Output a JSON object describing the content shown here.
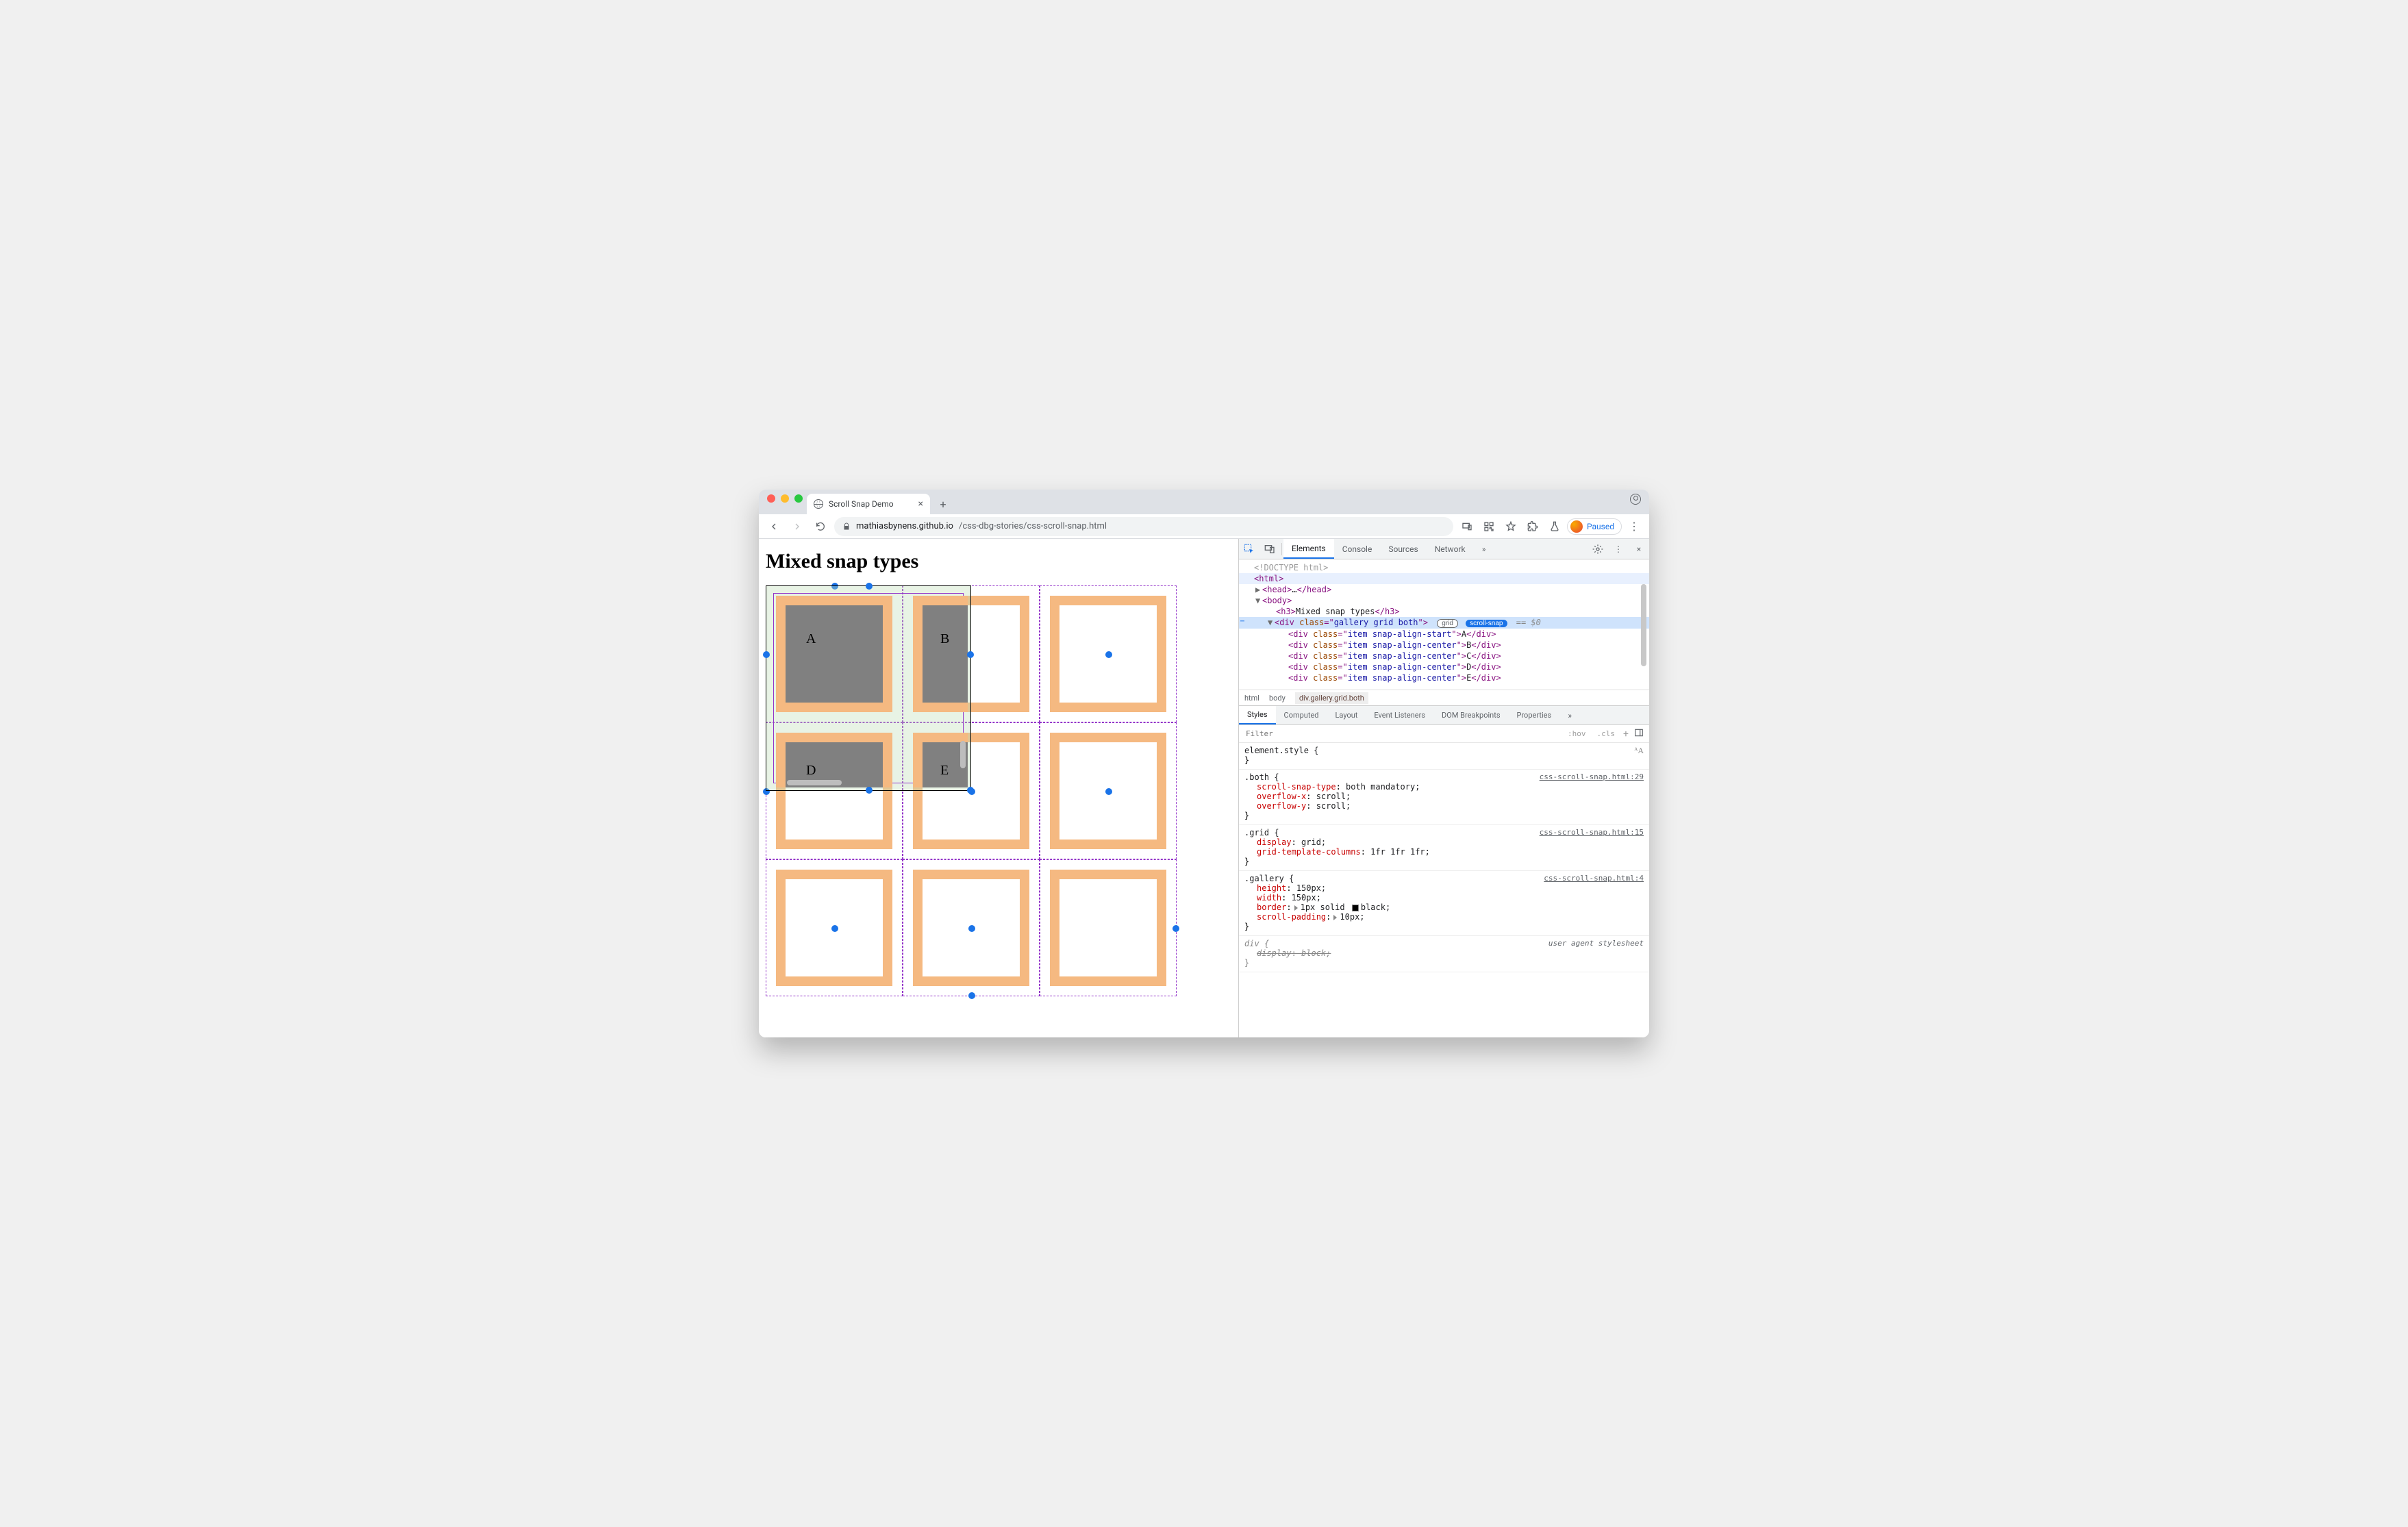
{
  "browser": {
    "tab_title": "Scroll Snap Demo",
    "url_domain": "mathiasbynens.github.io",
    "url_path": "/css-dbg-stories/css-scroll-snap.html",
    "paused_label": "Paused"
  },
  "page": {
    "heading": "Mixed snap types",
    "gallery_items": [
      "A",
      "B",
      "D",
      "E"
    ]
  },
  "devtools": {
    "tabs": [
      "Elements",
      "Console",
      "Sources",
      "Network"
    ],
    "dom": {
      "doctype": "<!DOCTYPE html>",
      "html_open": "<html>",
      "head": {
        "open": "<head>",
        "ellipsis": "…",
        "close": "</head>"
      },
      "body_open": "<body>",
      "h3": {
        "open": "<h3>",
        "text": "Mixed snap types",
        "close": "</h3>"
      },
      "gallery": {
        "tag": "div",
        "class_attr": "class",
        "class_val": "gallery grid both",
        "badge_grid": "grid",
        "badge_snap": "scroll-snap",
        "eq": "== $0"
      },
      "items": [
        {
          "cls": "item snap-align-start",
          "txt": "A"
        },
        {
          "cls": "item snap-align-center",
          "txt": "B"
        },
        {
          "cls": "item snap-align-center",
          "txt": "C"
        },
        {
          "cls": "item snap-align-center",
          "txt": "D"
        },
        {
          "cls": "item snap-align-center",
          "txt": "E"
        }
      ]
    },
    "crumbs": [
      "html",
      "body",
      "div.gallery.grid.both"
    ],
    "styles_tabs": [
      "Styles",
      "Computed",
      "Layout",
      "Event Listeners",
      "DOM Breakpoints",
      "Properties"
    ],
    "filter_placeholder": "Filter",
    "hov": ":hov",
    "cls": ".cls",
    "rules": {
      "element_style": "element.style {",
      "both": {
        "sel": ".both {",
        "src": "css-scroll-snap.html:29",
        "p1": "scroll-snap-type",
        "v1": "both mandatory;",
        "p2": "overflow-x",
        "v2": "scroll;",
        "p3": "overflow-y",
        "v3": "scroll;"
      },
      "grid": {
        "sel": ".grid {",
        "src": "css-scroll-snap.html:15",
        "p1": "display",
        "v1": "grid;",
        "p2": "grid-template-columns",
        "v2": "1fr 1fr 1fr;"
      },
      "gallery": {
        "sel": ".gallery {",
        "src": "css-scroll-snap.html:4",
        "p1": "height",
        "v1": "150px;",
        "p2": "width",
        "v2": "150px;",
        "p3": "border",
        "v3a": "1px solid ",
        "v3b": "black;",
        "p4": "scroll-padding",
        "v4": "10px;"
      },
      "ua": {
        "sel": "div {",
        "src": "user agent stylesheet",
        "p1": "display",
        "v1": "block;"
      },
      "brace_close": "}"
    }
  }
}
